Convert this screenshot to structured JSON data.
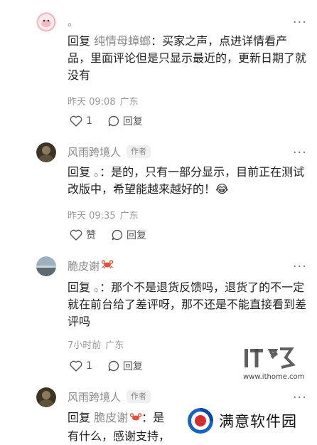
{
  "comments": [
    {
      "name": "。",
      "badge": "",
      "body_prefix": "回复 ",
      "reply_target": "纯情母蟑螂",
      "body": "：买家之声，点进详情看产品，里面评论但是只显示最近的，更新日期了就没有",
      "time": "昨天 09:08",
      "location": "广东",
      "like_count": "1",
      "reply_label": "回复"
    },
    {
      "name": "风雨跨境人",
      "badge": "作者",
      "body_prefix": "回复 ",
      "reply_target": "。",
      "body": "：是的，只有一部分显示，目前正在测试改版中，希望能越来越好的！",
      "emoji": "😂",
      "time": "昨天 09:35",
      "location": "广东",
      "like_label": "赞",
      "reply_label": "回复"
    },
    {
      "name": "脆皮谢",
      "badge": "",
      "body_prefix": "回复 ",
      "reply_target": "。",
      "body": "：那个不是退货反馈吗，退货了的不一定就在前台给了差评呀，那不还是不能直接看到差评吗",
      "time": "7小时前",
      "location": "广东",
      "like_count": "1",
      "reply_label": "回复"
    },
    {
      "name": "风雨跨境人",
      "badge": "作者",
      "body_prefix": "回复 ",
      "reply_target": "脆皮谢",
      "body_line1": "：是",
      "body_line2": "有什么，感谢支持，"
    }
  ],
  "watermarks": {
    "ithome_text": "www.ithome.com",
    "mysoft_text": "满意软件园"
  },
  "more_label": "···",
  "colors": {
    "crab": "#e0553a",
    "meta": "#999999",
    "name": "#8a8a8a"
  }
}
